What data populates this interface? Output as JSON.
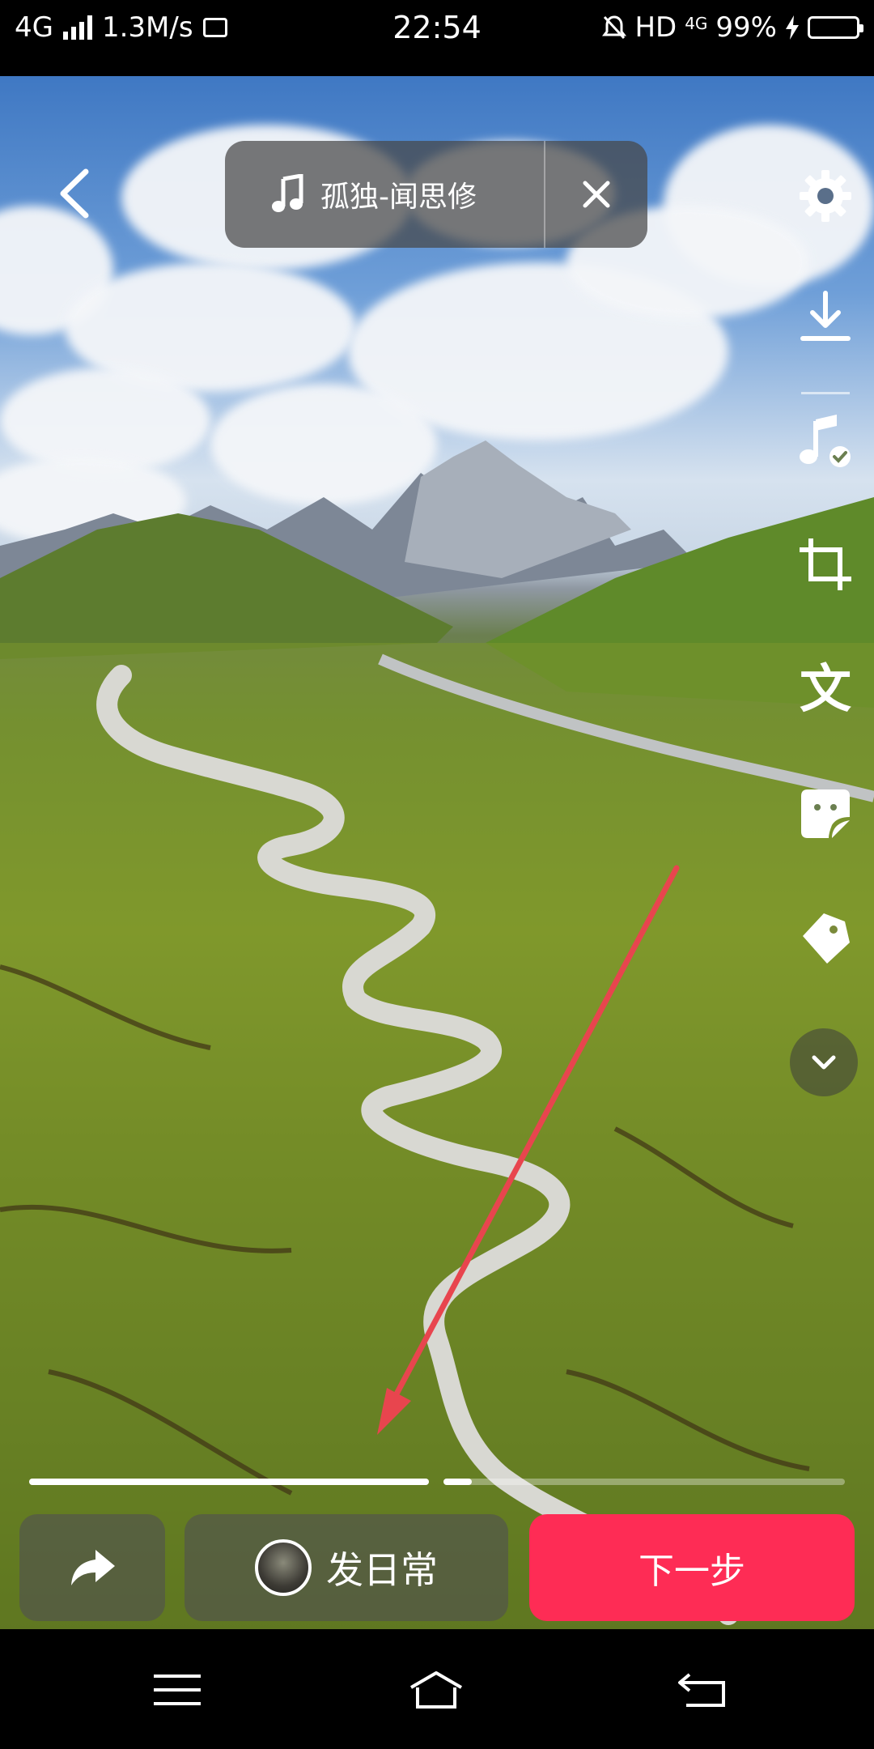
{
  "status_bar": {
    "network": "4G",
    "speed": "1.3M/s",
    "time": "22:54",
    "hd": "HD",
    "net2": "4G",
    "battery_percent": "99%",
    "battery_level": 0.99
  },
  "music": {
    "title": "孤独-闻思修"
  },
  "side_tools": [
    {
      "icon": "gear-icon"
    },
    {
      "icon": "download-icon"
    },
    {
      "icon": "music-check-icon"
    },
    {
      "icon": "crop-icon"
    },
    {
      "icon": "text-icon",
      "glyph": "文"
    },
    {
      "icon": "sticker-icon"
    },
    {
      "icon": "tag-icon"
    },
    {
      "icon": "chevron-down-icon"
    }
  ],
  "progress": {
    "segments": [
      {
        "fraction": 1.0,
        "state": "done"
      },
      {
        "fraction": 0.07,
        "state": "current"
      }
    ]
  },
  "actions": {
    "daily_label": "发日常",
    "next_label": "下一步"
  },
  "colors": {
    "accent": "#fe2c55",
    "annotation": "#e8454e"
  }
}
